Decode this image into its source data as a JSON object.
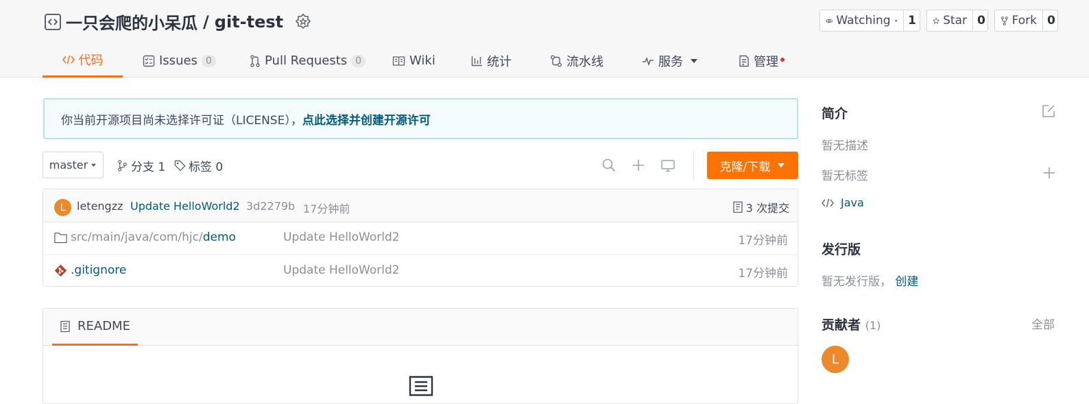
{
  "repo": {
    "owner": "一只会爬的小呆瓜",
    "separator": "/",
    "name": "git-test",
    "watch_label": "Watching",
    "watch_count": "1",
    "star_label": "Star",
    "star_count": "0",
    "fork_label": "Fork",
    "fork_count": "0"
  },
  "tabs": [
    {
      "label": "代码",
      "icon": "code-icon"
    },
    {
      "label": "Issues",
      "count": "0",
      "icon": "issues-icon"
    },
    {
      "label": "Pull Requests",
      "count": "0",
      "icon": "pull-request-icon"
    },
    {
      "label": "Wiki",
      "icon": "book-icon"
    },
    {
      "label": "统计",
      "icon": "bar-chart-icon"
    },
    {
      "label": "流水线",
      "icon": "pipeline-icon"
    },
    {
      "label": "服务",
      "icon": "pulse-icon"
    },
    {
      "label": "管理",
      "icon": "manage-icon"
    }
  ],
  "notice": {
    "text": "你当前开源项目尚未选择许可证（LICENSE），",
    "link": "点此选择并创建开源许可"
  },
  "toolbar": {
    "branch": "master",
    "branches": "分支 1",
    "tags": "标签 0",
    "clone": "克隆/下载"
  },
  "commit": {
    "avatar_letter": "L",
    "author": "letengzz",
    "message": "Update HelloWorld2",
    "sha": "3d2279b",
    "time": "17分钟前",
    "count_label": "3 次提交"
  },
  "files": [
    {
      "path_prefix": "src/main/java/com/hjc/",
      "name": "demo",
      "message": "Update HelloWorld2",
      "time": "17分钟前",
      "icon": "folder-icon"
    },
    {
      "path_prefix": "",
      "name": ".gitignore",
      "message": "Update HelloWorld2",
      "time": "17分钟前",
      "icon": "git-file-icon"
    }
  ],
  "readme": {
    "label": "README"
  },
  "sidebar": {
    "intro_title": "简介",
    "no_desc": "暂无描述",
    "no_tags": "暂无标签",
    "language": "Java",
    "release_title": "发行版",
    "no_release": "暂无发行版，",
    "create_link": "创建",
    "contrib_title": "贡献者",
    "contrib_count": "(1)",
    "all_link": "全部",
    "contrib_avatar": "L"
  },
  "colors": {
    "accent": "#fe7300",
    "link": "#005980"
  }
}
